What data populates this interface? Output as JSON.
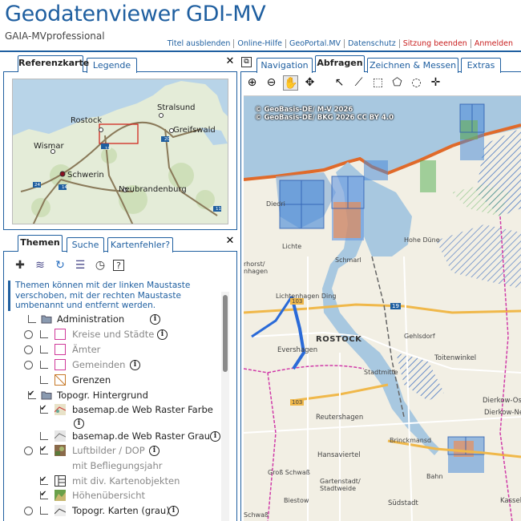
{
  "header": {
    "title": "Geodatenviewer GDI-MV",
    "subtitle": "GAIA-MVprofessional",
    "links": [
      {
        "label": "Titel ausblenden",
        "red": false
      },
      {
        "label": "Online-Hilfe",
        "red": false
      },
      {
        "label": "GeoPortal.MV",
        "red": false
      },
      {
        "label": "Datenschutz",
        "red": false
      },
      {
        "label": "Sitzung beenden",
        "red": true
      },
      {
        "label": "Anmelden",
        "red": true
      }
    ]
  },
  "left_top_tabs": {
    "referenzkarte": "Referenzkarte",
    "legende": "Legende"
  },
  "ref_map": {
    "cities": {
      "stralsund": "Stralsund",
      "rostock": "Rostock",
      "greifswald": "Greifswald",
      "wismar": "Wismar",
      "schwerin": "Schwerin",
      "neubrandenburg": "Neubrandenburg"
    },
    "shields": {
      "a19": "19",
      "a20": "20",
      "a14": "14",
      "a24": "24",
      "a11": "11"
    }
  },
  "left_bottom_tabs": {
    "themen": "Themen",
    "suche": "Suche",
    "kartenfehler": "Kartenfehler?"
  },
  "themes_info": "Themen können mit der linken Maustaste verschoben, mit der rechten Maustaste umbenannt und entfernt werden.",
  "tree": {
    "administration": "Administration",
    "kreise": "Kreise und Städte",
    "aemter": "Ämter",
    "gemeinden": "Gemeinden",
    "grenzen": "Grenzen",
    "topogr_hintergrund": "Topogr. Hintergrund",
    "basemap_farbe": "basemap.de Web Raster Farbe",
    "basemap_grau": "basemap.de Web Raster Grau",
    "luftbilder": "Luftbilder / DOP",
    "befliegung": "mit Befliegungsjahr",
    "kartenobjekte": "mit div. Kartenobjekten",
    "hoehen": "Höhenübersicht",
    "topogr_karten": "Topogr. Karten (grau)"
  },
  "right_tabs": {
    "navigation": "Navigation",
    "abfragen": "Abfragen",
    "zeichnen": "Zeichnen & Messen",
    "extras": "Extras"
  },
  "main_map": {
    "copyright": [
      "© GeoBasis-DE/ M-V 2026",
      "© GeoBasis-DE/ BKG 2026 CC BY 4.0"
    ],
    "labels": {
      "rostock": "ROSTOCK",
      "toitenwinkel": "Toitenwinkel",
      "evershagen": "Evershagen",
      "dierkow": "Dierkow-Ost",
      "dierkow2": "Dierkow-Ne",
      "reutershagen": "Reutershagen",
      "gartenstadt": "Gartenstadt/\nStadtweide",
      "hansaviertel": "Hansaviertel",
      "suedstadt": "Südstadt",
      "kassebohm": "Kassebo",
      "lichtenhagen": "Lichte",
      "lichtenhagen2": "Lichtenhagen Ding",
      "schmarl": "Schmarl",
      "hohe_duene": "Hohe Düne",
      "brinckmansdorf": "Brinckmansd",
      "grossmoor": "Groß Schwaß",
      "biest": "Biestow",
      "gehlsdorf": "Gehlsdorf",
      "stadtmitte": "Stadtmitte",
      "warnemunde": "Diedri",
      "ortsnahe": "rhorst/\nnhagen",
      "rbahn": "Bahn",
      "schwass": "Schwaß",
      "r103": "103",
      "r19": "19",
      "r103b": "103"
    }
  }
}
